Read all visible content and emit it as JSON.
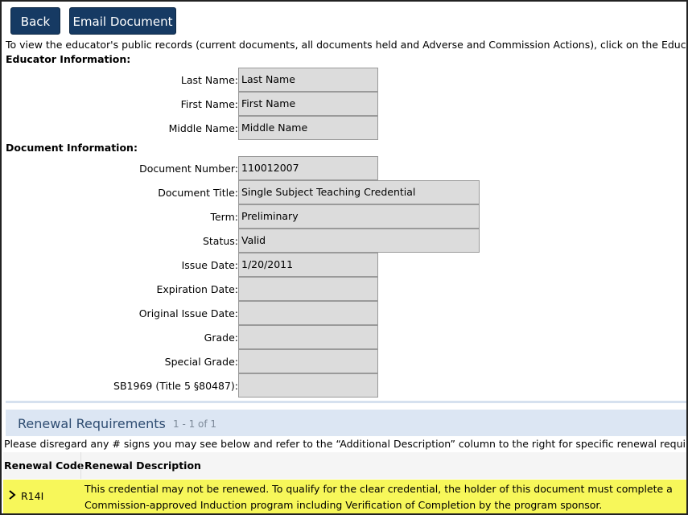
{
  "toolbar": {
    "back_label": "Back",
    "email_label": "Email Document"
  },
  "intro_text": "To view the educator's public records (current documents, all documents held and Adverse and Commission Actions), click on the Educator's Last",
  "educator": {
    "heading": "Educator Information:",
    "fields": [
      {
        "label": "Last Name:",
        "value": "Last Name"
      },
      {
        "label": "First Name:",
        "value": "First Name"
      },
      {
        "label": "Middle Name:",
        "value": "Middle Name"
      }
    ]
  },
  "document": {
    "heading": "Document Information:",
    "fields": [
      {
        "label": "Document Number:",
        "value": "110012007"
      },
      {
        "label": "Document Title:",
        "value": "Single Subject Teaching Credential"
      },
      {
        "label": "Term:",
        "value": "Preliminary"
      },
      {
        "label": "Status:",
        "value": "Valid"
      },
      {
        "label": "Issue Date:",
        "value": "1/20/2011"
      },
      {
        "label": "Expiration Date:",
        "value": ""
      },
      {
        "label": "Original Issue Date:",
        "value": ""
      },
      {
        "label": "Grade:",
        "value": ""
      },
      {
        "label": "Special Grade:",
        "value": ""
      },
      {
        "label": "SB1969 (Title 5 §80487):",
        "value": ""
      }
    ]
  },
  "renewal": {
    "title": "Renewal Requirements",
    "count": "1 - 1 of 1",
    "note": "Please disregard any # signs you may see below and refer to the “Additional Description” column to the right for specific renewal requirements.",
    "columns": [
      "Renewal Code",
      "Renewal Description"
    ],
    "rows": [
      {
        "code": "R14I",
        "description": "This credential may not be renewed.  To qualify for the clear credential, the holder of this document must complete a Commission-approved Induction program including Verification of Completion by the program sponsor."
      }
    ]
  },
  "colors": {
    "button_bg": "#163a63",
    "row_highlight": "#f7f75a",
    "field_bg": "#dcdcdc",
    "section_bar": "#dce6f3"
  },
  "icons": {
    "row_expand": "chevron-right-icon"
  }
}
